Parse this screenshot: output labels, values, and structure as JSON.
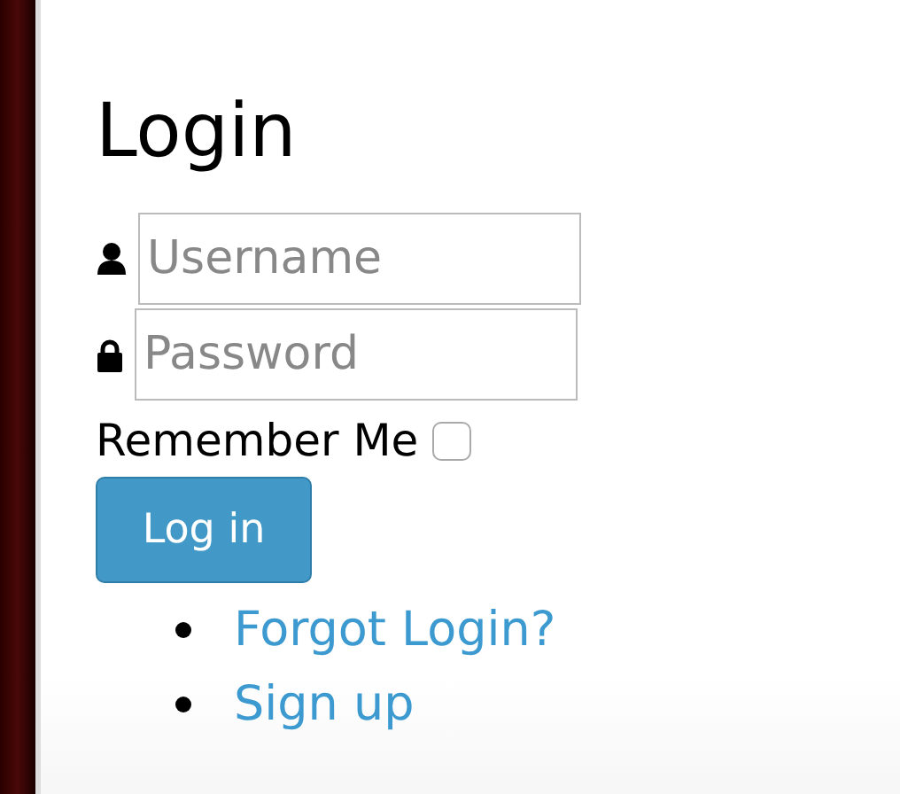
{
  "title": "Login",
  "fields": [
    {
      "kind": "user",
      "placeholder": "Username"
    },
    {
      "kind": "lock",
      "placeholder": "Password"
    }
  ],
  "remember": {
    "label": "Remember Me",
    "checked": false
  },
  "button": "Log in",
  "links": [
    "Forgot Login?",
    "Sign up"
  ]
}
